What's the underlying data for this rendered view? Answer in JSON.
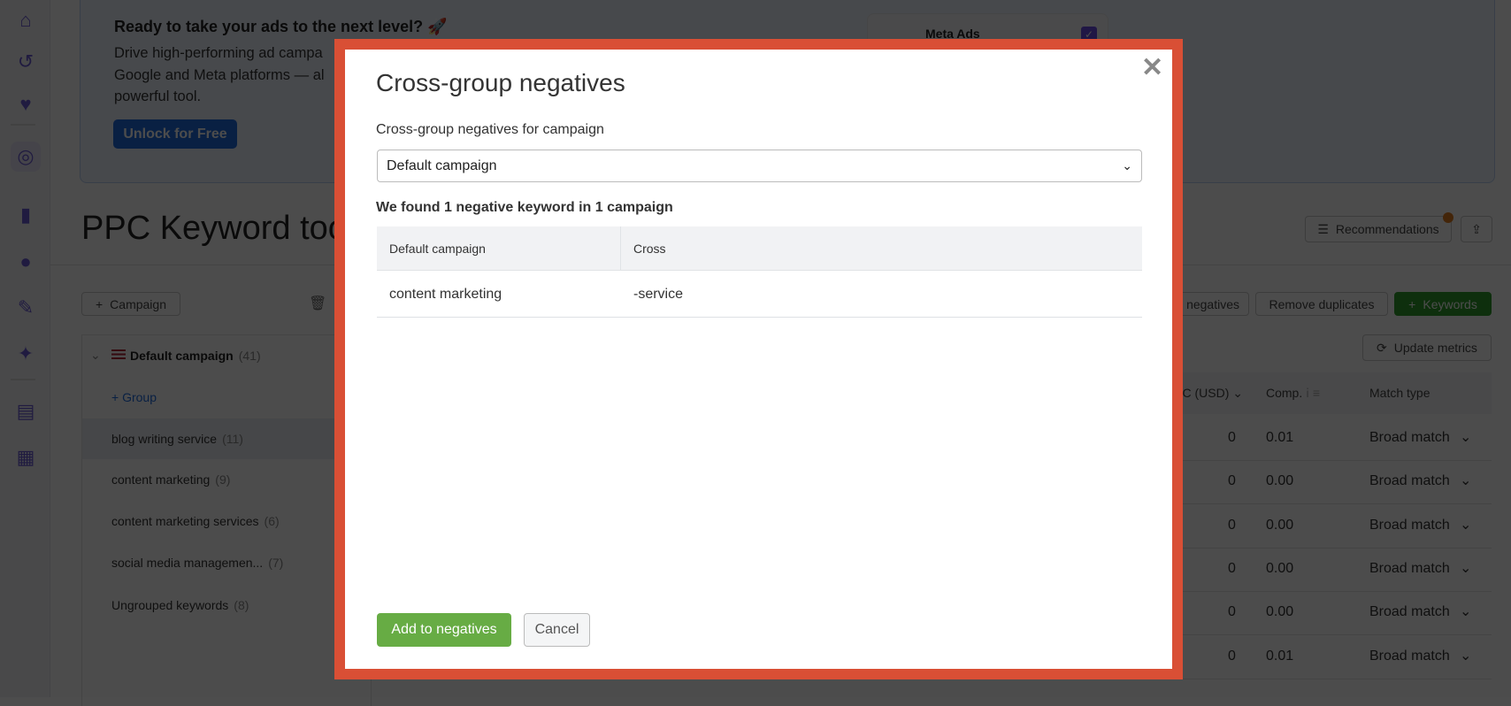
{
  "sidebar": {
    "icons": [
      "home-icon",
      "refresh-search-icon",
      "heart-chat-icon",
      "target-click-icon",
      "bar-chart-icon",
      "location-pin-icon",
      "edit-icon",
      "sparkle-chart-icon",
      "document-icon",
      "apps-grid-icon"
    ]
  },
  "banner": {
    "title": "Ready to take your ads to the next level? 🚀",
    "lines": [
      "Drive high-performing ad campa",
      "Google and Meta platforms — al",
      "powerful tool."
    ],
    "unlock_label": "Unlock for Free",
    "meta_label": "Meta Ads"
  },
  "page": {
    "title": "PPC Keyword tool",
    "recommendations_label": "Recommendations",
    "campaign_button": "Campaign",
    "negatives_button": "negatives",
    "remove_duplicates": "Remove duplicates",
    "keywords_button": "Keywords",
    "update_metrics": "Update metrics"
  },
  "campaign_panel": {
    "campaign_name": "Default campaign",
    "campaign_count": "(41)",
    "add_group": "Group",
    "groups": [
      {
        "name": "blog writing service",
        "count": "(11)"
      },
      {
        "name": "content marketing",
        "count": "(9)"
      },
      {
        "name": "content marketing services",
        "count": "(6)"
      },
      {
        "name": "social media managemen...",
        "count": "(7)"
      },
      {
        "name": "Ungrouped keywords",
        "count": "(8)"
      }
    ]
  },
  "keyword_table": {
    "headers": {
      "cpc": "CPC (USD)",
      "comp": "Comp.",
      "match": "Match type"
    },
    "rows": [
      {
        "cpc": "0",
        "comp": "0.01",
        "match": "Broad match"
      },
      {
        "cpc": "0",
        "comp": "0.00",
        "match": "Broad match"
      },
      {
        "cpc": "0",
        "comp": "0.00",
        "match": "Broad match"
      },
      {
        "cpc": "0",
        "comp": "0.00",
        "match": "Broad match"
      },
      {
        "cpc": "0",
        "comp": "0.00",
        "match": "Broad match"
      },
      {
        "cpc": "0",
        "comp": "0.01",
        "match": "Broad match"
      }
    ]
  },
  "modal": {
    "title": "Cross-group negatives",
    "field_label": "Cross-group negatives for campaign",
    "selected_campaign": "Default campaign",
    "found_text": "We found 1 negative keyword in 1 campaign",
    "table_headers": [
      "Default campaign",
      "Cross"
    ],
    "table_rows": [
      [
        "content marketing",
        "-service"
      ]
    ],
    "add_button": "Add to negatives",
    "cancel_button": "Cancel",
    "border_color": "#d94f35",
    "accent_green": "#67ac44"
  }
}
